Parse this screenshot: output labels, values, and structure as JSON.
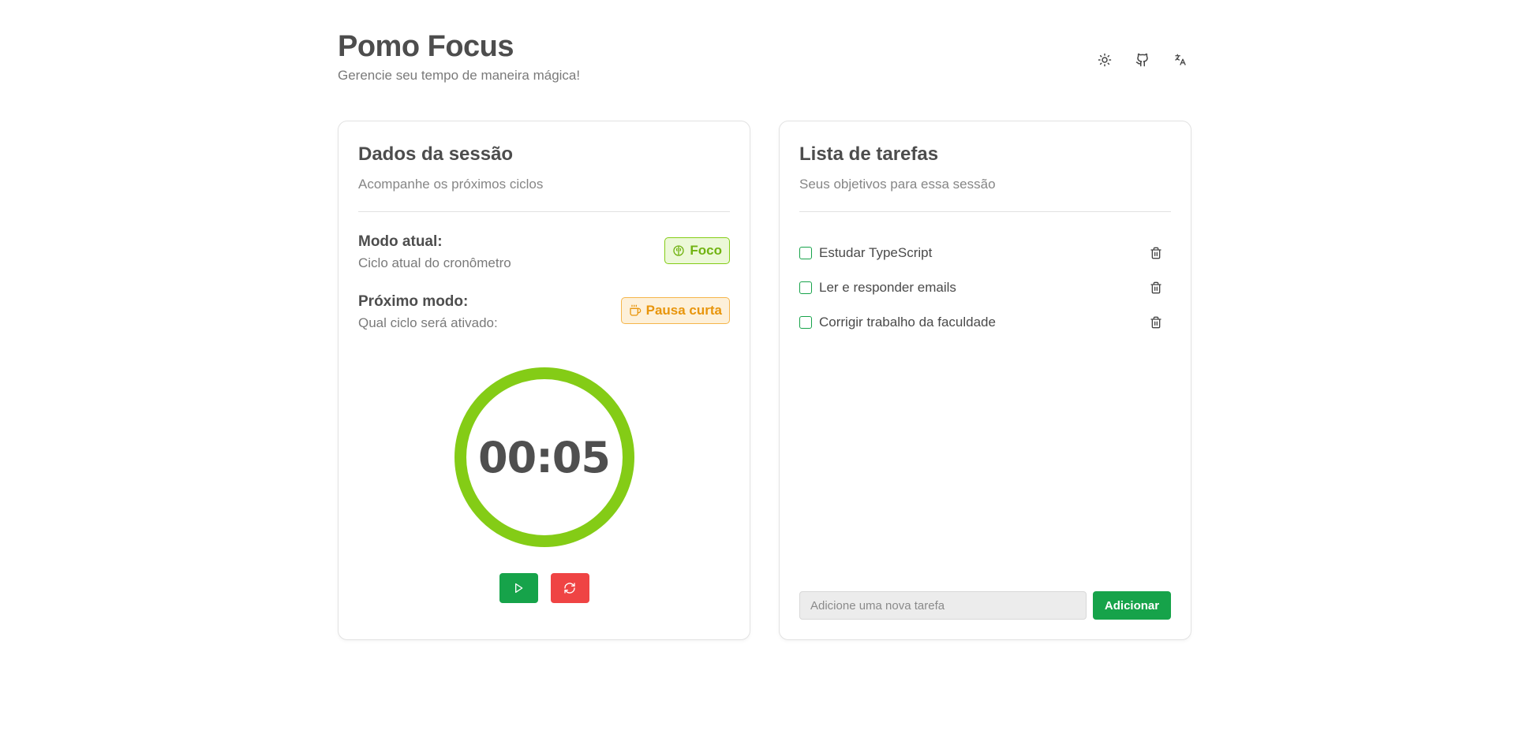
{
  "header": {
    "title": "Pomo Focus",
    "subtitle": "Gerencie seu tempo de maneira mágica!",
    "icons": [
      "sun-icon",
      "github-icon",
      "translate-icon"
    ]
  },
  "session": {
    "title": "Dados da sessão",
    "subtitle": "Acompanhe os próximos ciclos",
    "current_mode": {
      "label": "Modo atual:",
      "description": "Ciclo atual do cronômetro",
      "badge": "Foco",
      "badge_icon": "brain-icon",
      "color": "#84cc16"
    },
    "next_mode": {
      "label": "Próximo modo:",
      "description": "Qual ciclo será ativado:",
      "badge": "Pausa curta",
      "badge_icon": "coffee-icon",
      "color": "#f59e0b"
    },
    "timer": {
      "display": "00:05",
      "ring_color": "#84cc16"
    },
    "controls": {
      "play_icon": "play-icon",
      "play_color": "#16a34a",
      "reset_icon": "refresh-icon",
      "reset_color": "#ef4444"
    }
  },
  "tasks": {
    "title": "Lista de tarefas",
    "subtitle": "Seus objetivos para essa sessão",
    "items": [
      {
        "text": "Estudar TypeScript",
        "done": false
      },
      {
        "text": "Ler e responder emails",
        "done": false
      },
      {
        "text": "Corrigir trabalho da faculdade",
        "done": false
      }
    ],
    "input_placeholder": "Adicione uma nova tarefa",
    "input_value": "",
    "add_label": "Adicionar",
    "accent": "#16a34a"
  }
}
